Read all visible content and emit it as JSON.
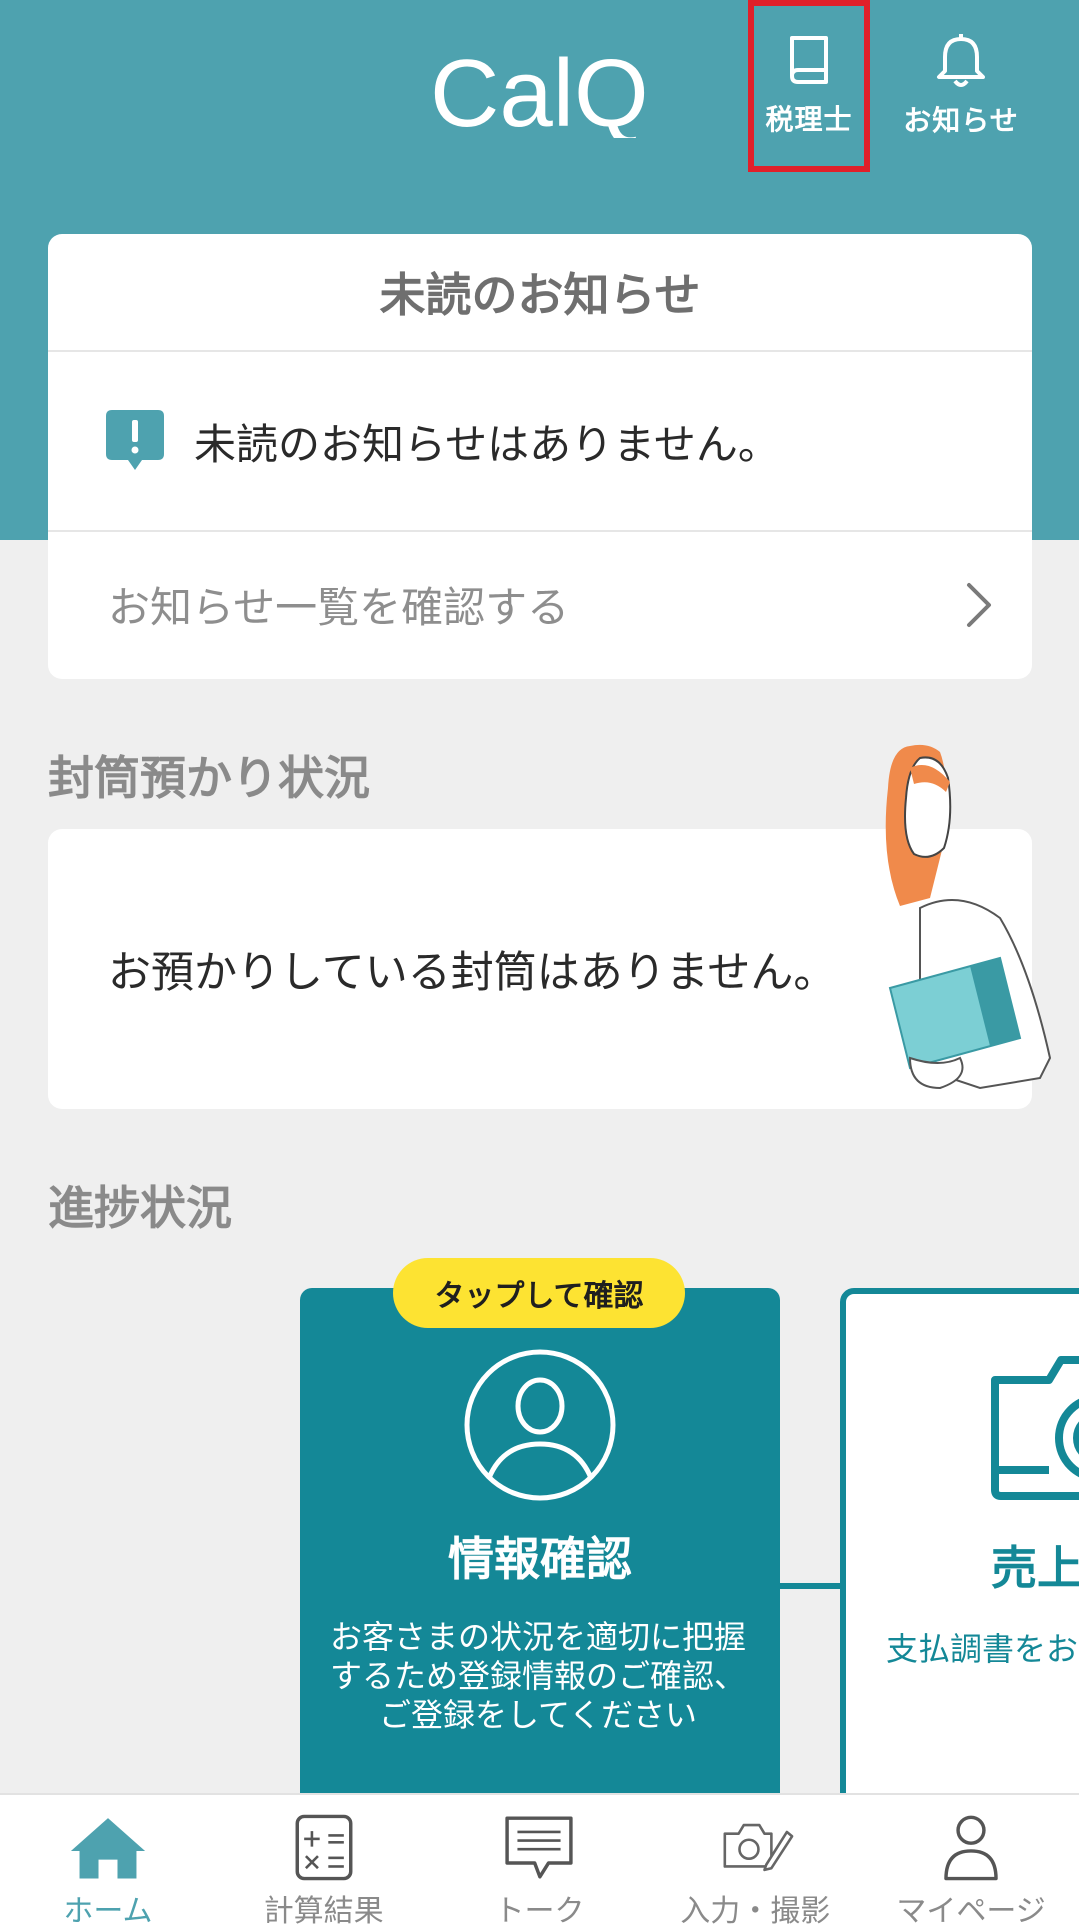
{
  "header": {
    "logo_text": "CalQ",
    "zeirishi_label": "税理士",
    "oshirase_label": "お知らせ",
    "accent_color": "#4ea2af"
  },
  "notices": {
    "title": "未読のお知らせ",
    "empty_message": "未読のお知らせはありません。",
    "view_all_label": "お知らせ一覧を確認する"
  },
  "envelope": {
    "section_title": "封筒預かり状況",
    "message": "お預かりしている封筒はありません。"
  },
  "progress": {
    "section_title": "進捗状況",
    "badge": "タップして確認",
    "steps": [
      {
        "title": "情報確認",
        "description": "お客さまの状況を適切に把握するため登録情報のご確認、ご登録をしてください"
      },
      {
        "title": "売上",
        "description": "支払調書をお"
      }
    ],
    "step_color": "#148897"
  },
  "tabbar": {
    "items": [
      {
        "label": "ホーム",
        "icon": "home-icon",
        "active": true
      },
      {
        "label": "計算結果",
        "icon": "calculator-icon",
        "active": false
      },
      {
        "label": "トーク",
        "icon": "chat-icon",
        "active": false
      },
      {
        "label": "入力・撮影",
        "icon": "camera-pen-icon",
        "active": false
      },
      {
        "label": "マイページ",
        "icon": "person-icon",
        "active": false
      }
    ]
  }
}
